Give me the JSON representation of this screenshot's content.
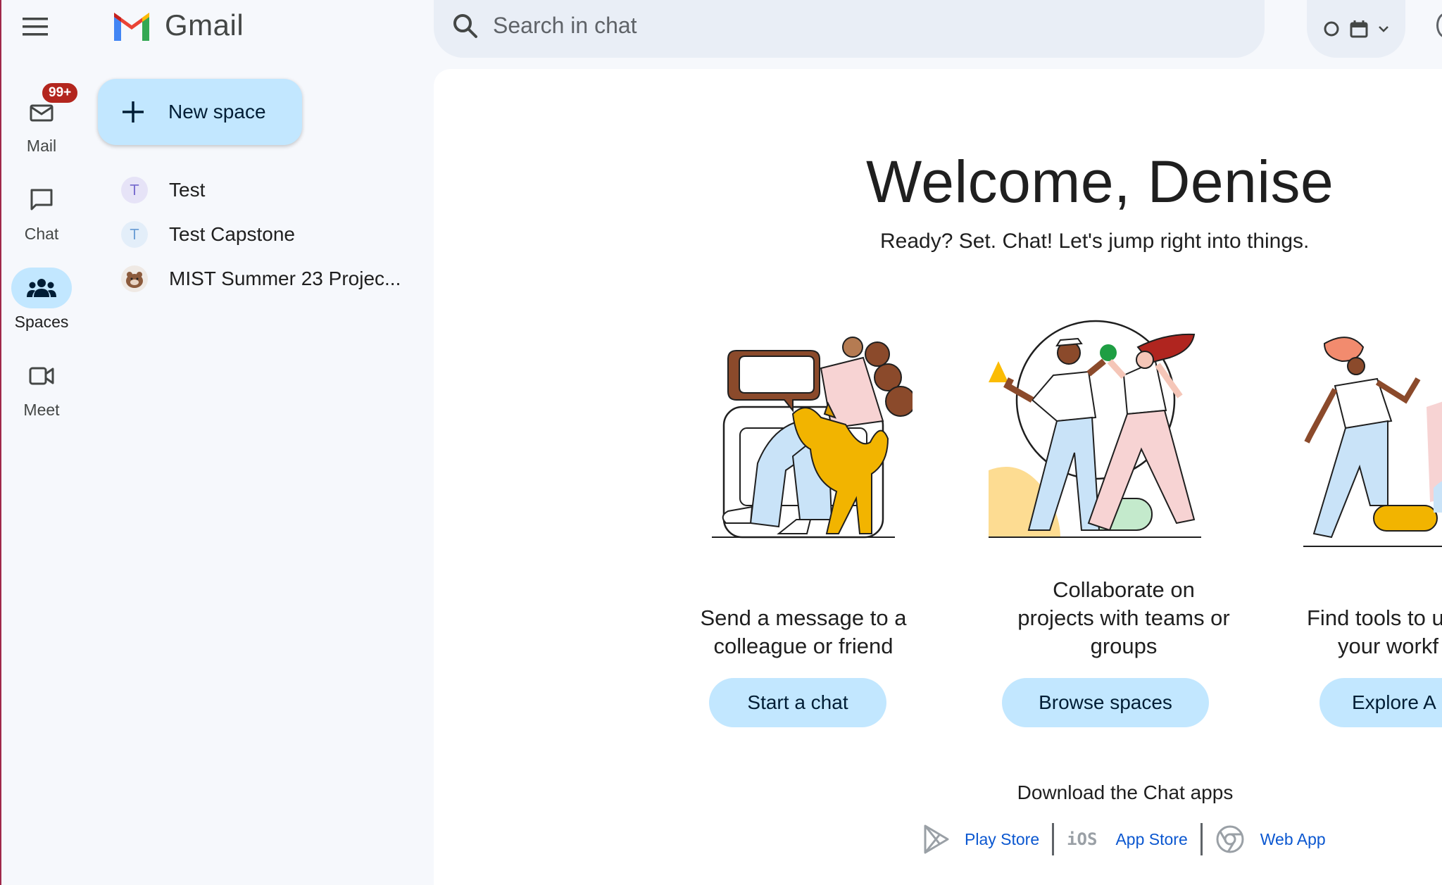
{
  "app": {
    "name": "Gmail"
  },
  "search": {
    "placeholder": "Search in chat"
  },
  "rail": {
    "mail": {
      "label": "Mail",
      "badge": "99+"
    },
    "chat": {
      "label": "Chat"
    },
    "spaces": {
      "label": "Spaces"
    },
    "meet": {
      "label": "Meet"
    }
  },
  "sidebar": {
    "new_space_label": "New space",
    "spaces": [
      {
        "label": "Test",
        "avatar": "T"
      },
      {
        "label": "Test Capstone",
        "avatar": "T"
      },
      {
        "label": "MIST Summer 23 Projec...",
        "avatar": ""
      }
    ]
  },
  "main": {
    "title": "Welcome, Denise",
    "subtitle": "Ready? Set. Chat! Let's jump right into things.",
    "cards": [
      {
        "line1": "Send a message to a",
        "line2": "colleague or friend",
        "line3": "",
        "button": "Start a chat"
      },
      {
        "line1": "Collaborate on",
        "line2": "projects with teams or",
        "line3": "groups",
        "button": "Browse spaces"
      },
      {
        "line1": "Find tools to u",
        "line2": "your workf",
        "line3": "",
        "button": "Explore A"
      }
    ],
    "download": {
      "title": "Download the Chat apps",
      "play_store": "Play Store",
      "ios_label": "iOS",
      "app_store": "App Store",
      "web_app": "Web App"
    }
  },
  "colors": {
    "accent": "#c2e7ff",
    "badge": "#b3261e",
    "link": "#0b57d0"
  }
}
